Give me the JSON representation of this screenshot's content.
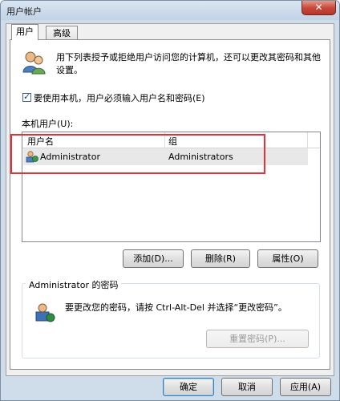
{
  "window": {
    "title": "用户帐户",
    "close_glyph": "✕"
  },
  "tabs": [
    {
      "label": "用户"
    },
    {
      "label": "高级"
    }
  ],
  "description": "用下列表授予或拒绝用户访问您的计算机，还可以更改其密码和其他设置。",
  "require_login": {
    "checked": true,
    "label": "要使用本机，用户必须输入用户名和密码(E)"
  },
  "users_section": {
    "label": "本机用户(U):"
  },
  "columns": {
    "username": "用户名",
    "group": "组"
  },
  "rows": [
    {
      "username": "Administrator",
      "group": "Administrators"
    }
  ],
  "buttons": {
    "add": "添加(D)...",
    "remove": "删除(R)",
    "properties": "属性(O)"
  },
  "password_group": {
    "title": "Administrator 的密码",
    "text": "要更改您的密码，请按 Ctrl-Alt-Del 并选择“更改密码”。",
    "reset_button": "重置密码(P)..."
  },
  "footer": {
    "ok": "确定",
    "cancel": "取消",
    "apply": "应用(A)"
  },
  "colors": {
    "highlight": "#e5323a",
    "close": "#c7483a"
  }
}
